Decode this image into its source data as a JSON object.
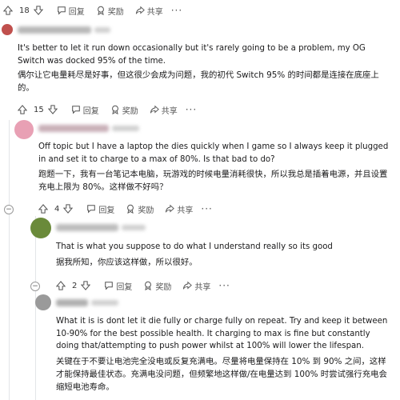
{
  "comments": [
    {
      "votes": "18",
      "reply_label": "回复",
      "award_label": "奖励",
      "share_label": "共享"
    },
    {
      "text_en": "It's better to let it run down occasionally but it's rarely going to be a problem, my OG Switch was docked 95% of the time.",
      "text_cn": "偶尔让它电量耗尽是好事，但这很少会成为问题，我的初代 Switch 95% 的时间都是连接在底座上的。",
      "votes": "15",
      "reply_label": "回复",
      "award_label": "奖励",
      "share_label": "共享"
    },
    {
      "text_en": "Off topic but I have a laptop the dies quickly when I game so I always keep it plugged in and set it to charge to a max of 80%. Is that bad to do?",
      "text_cn": "跑题一下，我有一台笔记本电脑，玩游戏的时候电量消耗很快，所以我总是插着电源，并且设置充电上限为 80%。这样做不好吗？",
      "votes": "4",
      "reply_label": "回复",
      "award_label": "奖励",
      "share_label": "共享"
    },
    {
      "text_en": "That is what you suppose to do what I understand really so its good",
      "text_cn": "据我所知，你应该这样做，所以很好。",
      "votes": "2",
      "reply_label": "回复",
      "award_label": "奖励",
      "share_label": "共享"
    },
    {
      "text_en": "What it is is dont let it die fully or charge fully on repeat. Try and keep it between 10-90% for the best possible health. It charging to max is fine but constantly doing that/attempting to push power whilst at 100% will lower the lifespan.",
      "text_cn": "关键在于不要让电池完全没电或反复充满电。尽量将电量保持在 10% 到 90% 之间，这样才能保持最佳状态。充满电没问题，但频繁地这样做/在电量达到 100% 时尝试强行充电会缩短电池寿命。"
    }
  ],
  "colors": {
    "avatar1": "#c0504d",
    "avatar2": "#e8a0b4",
    "avatar3": "#6a8a3a",
    "avatar4": "#9a9a9a"
  }
}
